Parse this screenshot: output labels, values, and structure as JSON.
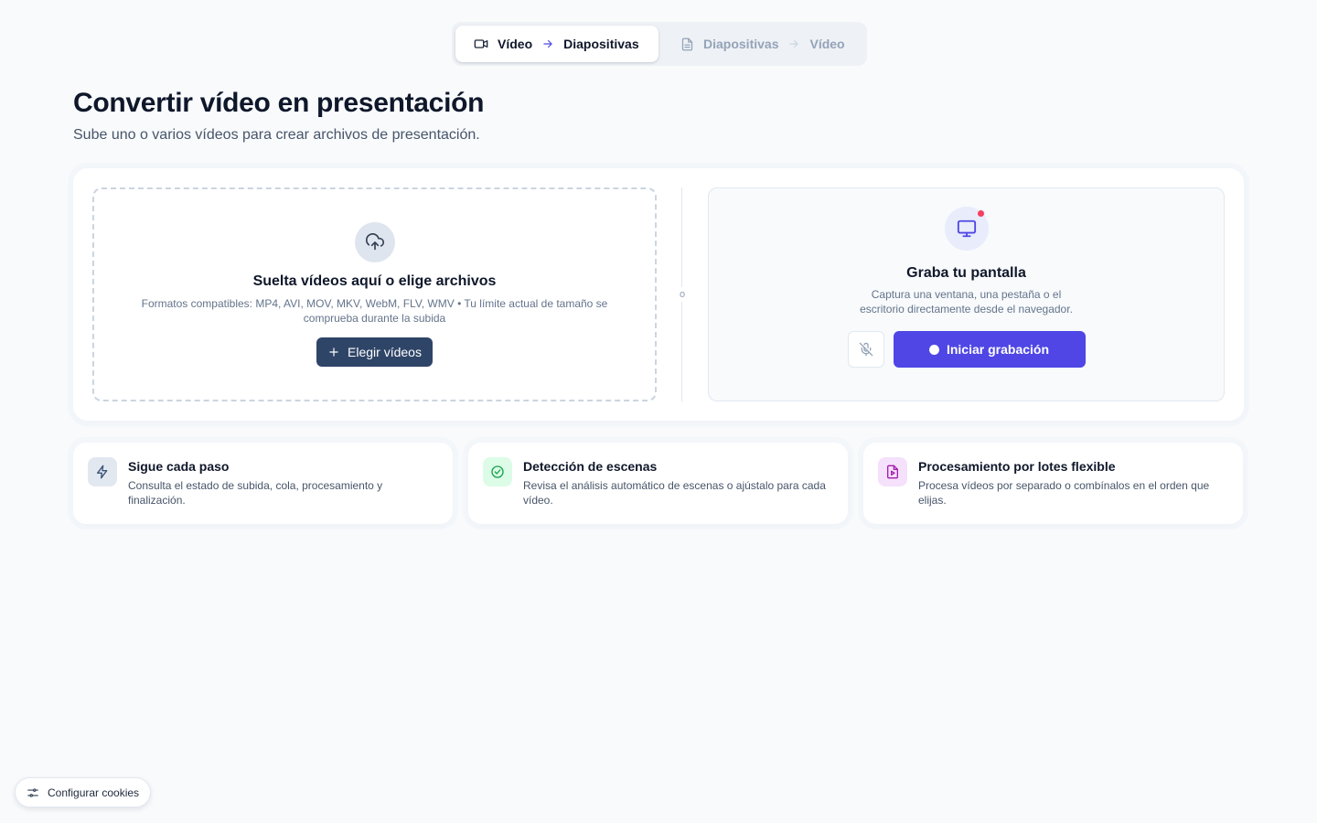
{
  "mode_switch": {
    "active": {
      "from": "Vídeo",
      "to": "Diapositivas",
      "icon": "video-camera-icon"
    },
    "inactive": {
      "from": "Diapositivas",
      "to": "Vídeo",
      "icon": "document-icon"
    }
  },
  "header": {
    "title": "Convertir vídeo en presentación",
    "subtitle": "Sube uno o varios vídeos para crear archivos de presentación."
  },
  "upload": {
    "icon": "cloud-upload-icon",
    "title": "Suelta vídeos aquí o elige archivos",
    "hint": "Formatos compatibles: MP4, AVI, MOV, MKV, WebM, FLV, WMV • Tu límite actual de tamaño se comprueba durante la subida",
    "button_label": "Elegir vídeos"
  },
  "divider_label": "o",
  "record": {
    "icon": "monitor-icon",
    "title": "Graba tu pantalla",
    "description": "Captura una ventana, una pestaña o el escritorio directamente desde el navegador.",
    "mic_icon": "microphone-off-icon",
    "button_label": "Iniciar grabación",
    "accent_color": "#4f46e5"
  },
  "features": [
    {
      "icon": "lightning-icon",
      "title": "Sigue cada paso",
      "description": "Consulta el estado de subida, cola, procesamiento y finalización.",
      "color": "#3b5477"
    },
    {
      "icon": "check-circle-icon",
      "title": "Detección de escenas",
      "description": "Revisa el análisis automático de escenas o ajústalo para cada vídeo.",
      "color": "#16a34a"
    },
    {
      "icon": "file-video-icon",
      "title": "Procesamiento por lotes flexible",
      "description": "Procesa vídeos por separado o combínalos en el orden que elijas.",
      "color": "#a21caf"
    }
  ],
  "cookie_button": {
    "label": "Configurar cookies",
    "icon": "sliders-icon"
  }
}
